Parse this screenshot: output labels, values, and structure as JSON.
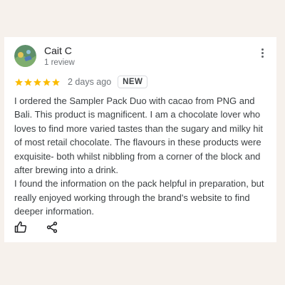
{
  "review": {
    "author": {
      "name": "Cait C",
      "reviews_count": "1 review",
      "avatar_icon": "avatar-photo"
    },
    "rating": 5,
    "rating_max": 5,
    "date": "2 days ago",
    "badge": "NEW",
    "text": [
      "I ordered the Sampler Pack Duo with cacao from PNG and Bali. This product is magnificent. I am a chocolate lover who loves to find more varied tastes than the sugary and milky hit of most retail chocolate. The flavours in these products were exquisite- both whilst nibbling from a corner of the block and after brewing into a drink.",
      "I found the information on the pack helpful in preparation, but really enjoyed working through the brand's website to find deeper information."
    ],
    "actions": {
      "like_icon": "thumbs-up-icon",
      "share_icon": "share-icon",
      "menu_icon": "more-vert-icon"
    }
  },
  "colors": {
    "background": "#f6f1ec",
    "card": "#ffffff",
    "star": "#fbbc04",
    "text": "#3c4043",
    "muted": "#70757a"
  }
}
